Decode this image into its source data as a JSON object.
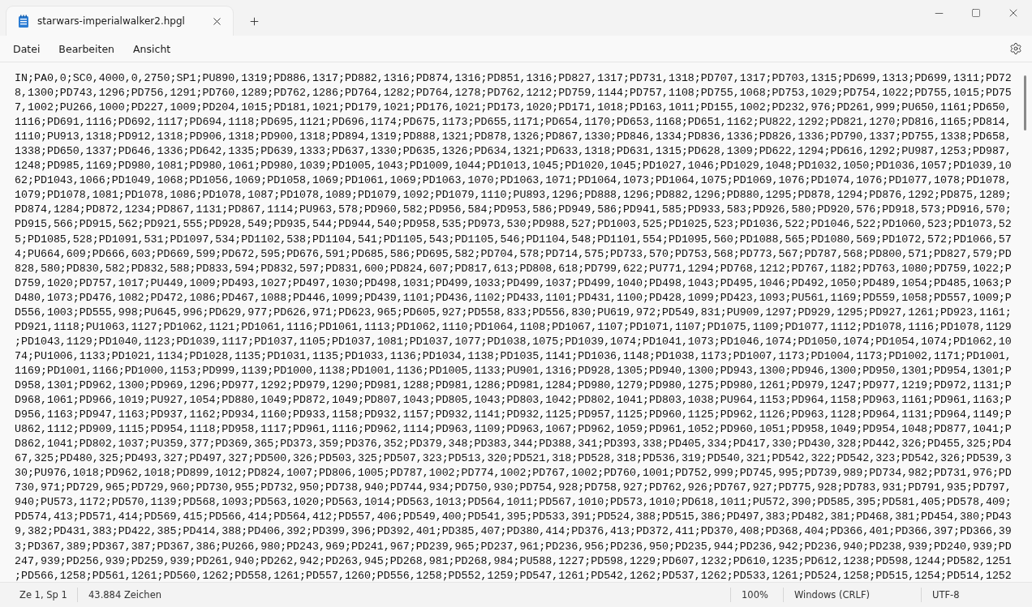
{
  "tabs": [
    {
      "title": "starwars-imperialwalker2.hpgl",
      "selected": true
    }
  ],
  "menu": [
    "Datei",
    "Bearbeiten",
    "Ansicht"
  ],
  "editor": {
    "lines": [
      "IN;PA0,0;SC0,4000,0,2750;SP1;PU890,1319;PD886,1317;PD882,1316;PD874,1316;PD851,1316;PD827,1317;PD731,1318;PD707,1317;PD703,1315;PD699,1313;PD699,1311;PD72",
      "8,1300;PD743,1296;PD756,1291;PD760,1289;PD762,1286;PD764,1282;PD764,1278;PD762,1212;PD759,1144;PD757,1108;PD755,1068;PD753,1029;PD754,1022;PD755,1015;PD75",
      "7,1002;PU266,1000;PD227,1009;PD204,1015;PD181,1021;PD179,1021;PD176,1021;PD173,1020;PD171,1018;PD163,1011;PD155,1002;PD232,976;PD261,999;PU650,1161;PD650,",
      "1116;PD691,1116;PD692,1117;PD694,1118;PD695,1121;PD696,1174;PD675,1173;PD655,1171;PD654,1170;PD653,1168;PD651,1162;PU822,1292;PD821,1270;PD816,1165;PD814,",
      "1110;PU913,1318;PD912,1318;PD906,1318;PD900,1318;PD894,1319;PD888,1321;PD878,1326;PD867,1330;PD846,1334;PD836,1336;PD826,1336;PD790,1337;PD755,1338;PD658,",
      "1338;PD650,1337;PD646,1336;PD642,1335;PD639,1333;PD637,1330;PD635,1326;PD634,1321;PD633,1318;PD631,1315;PD628,1309;PD622,1294;PD616,1292;PU987,1253;PD987,",
      "1248;PD985,1169;PD980,1081;PD980,1061;PD980,1039;PD1005,1043;PD1009,1044;PD1013,1045;PD1020,1045;PD1027,1046;PD1029,1048;PD1032,1050;PD1036,1057;PD1039,10",
      "62;PD1043,1066;PD1049,1068;PD1056,1069;PD1058,1069;PD1061,1069;PD1063,1070;PD1063,1071;PD1064,1073;PD1064,1075;PD1069,1076;PD1074,1076;PD1077,1078;PD1078,",
      "1079;PD1078,1081;PD1078,1086;PD1078,1087;PD1078,1089;PD1079,1092;PD1079,1110;PU893,1296;PD888,1296;PD882,1296;PD880,1295;PD878,1294;PD876,1292;PD875,1289;",
      "PD874,1284;PD872,1234;PD867,1131;PD867,1114;PU963,578;PD960,582;PD956,584;PD953,586;PD949,586;PD941,585;PD933,583;PD926,580;PD920,576;PD918,573;PD916,570;",
      "PD915,566;PD915,562;PD921,555;PD928,549;PD935,544;PD944,540;PD958,535;PD973,530;PD988,527;PD1003,525;PD1025,523;PD1036,522;PD1046,522;PD1060,523;PD1073,52",
      "5;PD1085,528;PD1091,531;PD1097,534;PD1102,538;PD1104,541;PD1105,543;PD1105,546;PD1104,548;PD1101,554;PD1095,560;PD1088,565;PD1080,569;PD1072,572;PD1066,57",
      "4;PU664,609;PD666,603;PD669,599;PD672,595;PD676,591;PD685,586;PD695,582;PD704,578;PD714,575;PD733,570;PD753,568;PD773,567;PD787,568;PD800,571;PD827,579;PD",
      "828,580;PD830,582;PD832,588;PD833,594;PD832,597;PD831,600;PD824,607;PD817,613;PD808,618;PD799,622;PU771,1294;PD768,1212;PD767,1182;PD763,1080;PD759,1022;P",
      "D759,1020;PD757,1017;PU449,1009;PD493,1027;PD497,1030;PD498,1031;PD499,1033;PD499,1037;PD499,1040;PD498,1043;PD495,1046;PD492,1050;PD489,1054;PD485,1063;P",
      "D480,1073;PD476,1082;PD472,1086;PD467,1088;PD446,1099;PD439,1101;PD436,1102;PD433,1101;PD431,1100;PD428,1099;PD423,1093;PU561,1169;PD559,1058;PD557,1009;P",
      "D556,1003;PD555,998;PU645,996;PD629,977;PD626,971;PD623,965;PD605,927;PD558,833;PD556,830;PU619,972;PD549,831;PU909,1297;PD929,1295;PD927,1261;PD923,1161;",
      "PD921,1118;PU1063,1127;PD1062,1121;PD1061,1116;PD1061,1113;PD1062,1110;PD1064,1108;PD1067,1107;PD1071,1107;PD1075,1109;PD1077,1112;PD1078,1116;PD1078,1129",
      ";PD1043,1129;PD1040,1123;PD1039,1117;PD1037,1105;PD1037,1081;PD1037,1077;PD1038,1075;PD1039,1074;PD1041,1073;PD1046,1074;PD1050,1074;PD1054,1074;PD1062,10",
      "74;PU1006,1133;PD1021,1134;PD1028,1135;PD1031,1135;PD1033,1136;PD1034,1138;PD1035,1141;PD1036,1148;PD1038,1173;PD1007,1173;PD1004,1173;PD1002,1171;PD1001,",
      "1169;PD1001,1166;PD1000,1153;PD999,1139;PD1000,1138;PD1001,1136;PD1005,1133;PU901,1316;PD928,1305;PD940,1300;PD943,1300;PD946,1300;PD950,1301;PD954,1301;P",
      "D958,1301;PD962,1300;PD969,1296;PD977,1292;PD979,1290;PD981,1288;PD981,1286;PD981,1284;PD980,1279;PD980,1275;PD980,1261;PD979,1247;PD977,1219;PD972,1131;P",
      "D968,1061;PD966,1019;PU927,1054;PD880,1049;PD872,1049;PD807,1043;PD805,1043;PD803,1042;PD802,1041;PD803,1038;PU964,1153;PD964,1158;PD963,1161;PD961,1163;P",
      "D956,1163;PD947,1163;PD937,1162;PD934,1160;PD933,1158;PD932,1157;PD932,1141;PD932,1125;PD957,1125;PD960,1125;PD962,1126;PD963,1128;PD964,1131;PD964,1149;P",
      "U862,1112;PD909,1115;PD954,1118;PD958,1117;PD961,1116;PD962,1114;PD963,1109;PD963,1067;PD962,1059;PD961,1052;PD960,1051;PD958,1049;PD954,1048;PD877,1041;P",
      "D862,1041;PD802,1037;PU359,377;PD369,365;PD373,359;PD376,352;PD379,348;PD383,344;PD388,341;PD393,338;PD405,334;PD417,330;PD430,328;PD442,326;PD455,325;PD4",
      "67,325;PD480,325;PD493,327;PD497,327;PD500,326;PD503,325;PD507,323;PD513,320;PD521,318;PD528,318;PD536,319;PD540,321;PD542,322;PD542,323;PD542,326;PD539,3",
      "30;PU976,1018;PD962,1018;PD899,1012;PD824,1007;PD806,1005;PD787,1002;PD774,1002;PD767,1002;PD760,1001;PD752,999;PD745,995;PD739,989;PD734,982;PD731,976;PD",
      "730,971;PD729,965;PD729,960;PD730,955;PD732,950;PD738,940;PD744,934;PD750,930;PD754,928;PD758,927;PD762,926;PD767,927;PD775,928;PD783,931;PD791,935;PD797,",
      "940;PU573,1172;PD570,1139;PD568,1093;PD563,1020;PD563,1014;PD563,1013;PD564,1011;PD567,1010;PD573,1010;PD618,1011;PU572,390;PD585,395;PD581,405;PD578,409;",
      "PD574,413;PD571,414;PD569,415;PD566,414;PD564,412;PD557,406;PD549,400;PD541,395;PD533,391;PD524,388;PD515,386;PD497,383;PD482,381;PD468,381;PD454,380;PD43",
      "9,382;PD431,383;PD422,385;PD414,388;PD406,392;PD399,396;PD392,401;PD385,407;PD380,414;PD376,413;PD372,411;PD370,408;PD368,404;PD366,401;PD366,397;PD366,39",
      "3;PD367,389;PD367,387;PD367,386;PU266,980;PD243,969;PD241,967;PD239,965;PD237,961;PD236,956;PD236,950;PD235,944;PD236,942;PD236,940;PD238,939;PD240,939;PD",
      "247,939;PD256,939;PD259,939;PD261,940;PD262,942;PD263,945;PD268,981;PD268,984;PU588,1227;PD598,1229;PD607,1232;PD610,1235;PD612,1238;PD598,1244;PD582,1251",
      ";PD566,1258;PD561,1261;PD560,1262;PD558,1261;PD557,1260;PD556,1258;PD552,1259;PD547,1261;PD542,1262;PD537,1262;PD533,1261;PD524,1258;PD515,1254;PD514,1252"
    ]
  },
  "status_bar": {
    "position": "Ze 1, Sp 1",
    "count": "43.884 Zeichen",
    "zoom": "100%",
    "line_endings": "Windows (CRLF)",
    "encoding": "UTF-8"
  }
}
